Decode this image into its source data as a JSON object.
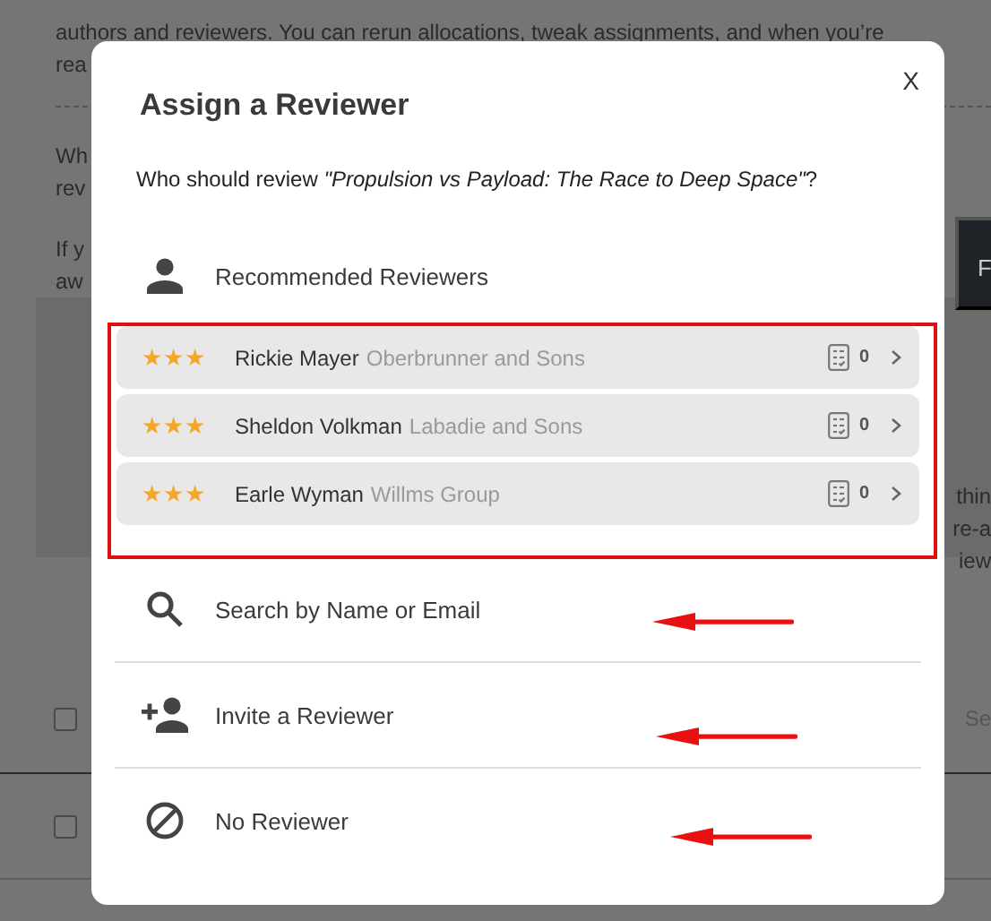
{
  "background_page": {
    "intro_lines": [
      "authors and reviewers. You can rerun allocations, tweak assignments, and when you’re",
      "rea"
    ],
    "para_lines": [
      "Wh",
      "rev"
    ],
    "para2_lines": [
      "If y",
      "aw"
    ],
    "side_button": "F",
    "panel_right_lines": [
      "thin",
      "re-a",
      "iew"
    ],
    "table_rows": [
      {
        "checked": false,
        "cell": "Se"
      },
      {
        "checked": false
      }
    ]
  },
  "dialog": {
    "title": "Assign a Reviewer",
    "close": "X",
    "question": "Who should review *\"Propulsion vs Payload: The Race to Deep Space\"*?",
    "recommended_header": "Recommended Reviewers",
    "reviewers": [
      {
        "name": "Rickie Mayer",
        "affiliation": "Oberbrunner and Sons",
        "stars": 3,
        "count": "0"
      },
      {
        "name": "Sheldon Volkman",
        "affiliation": "Labadie and Sons",
        "stars": 3,
        "count": "0"
      },
      {
        "name": "Earle Wyman",
        "affiliation": "Willms Group",
        "stars": 3,
        "count": "0"
      }
    ],
    "options": [
      {
        "kind": "search",
        "label": "Search by Name or Email"
      },
      {
        "kind": "invite",
        "label": "Invite a Reviewer"
      },
      {
        "kind": "none",
        "label": "No Reviewer"
      }
    ]
  }
}
